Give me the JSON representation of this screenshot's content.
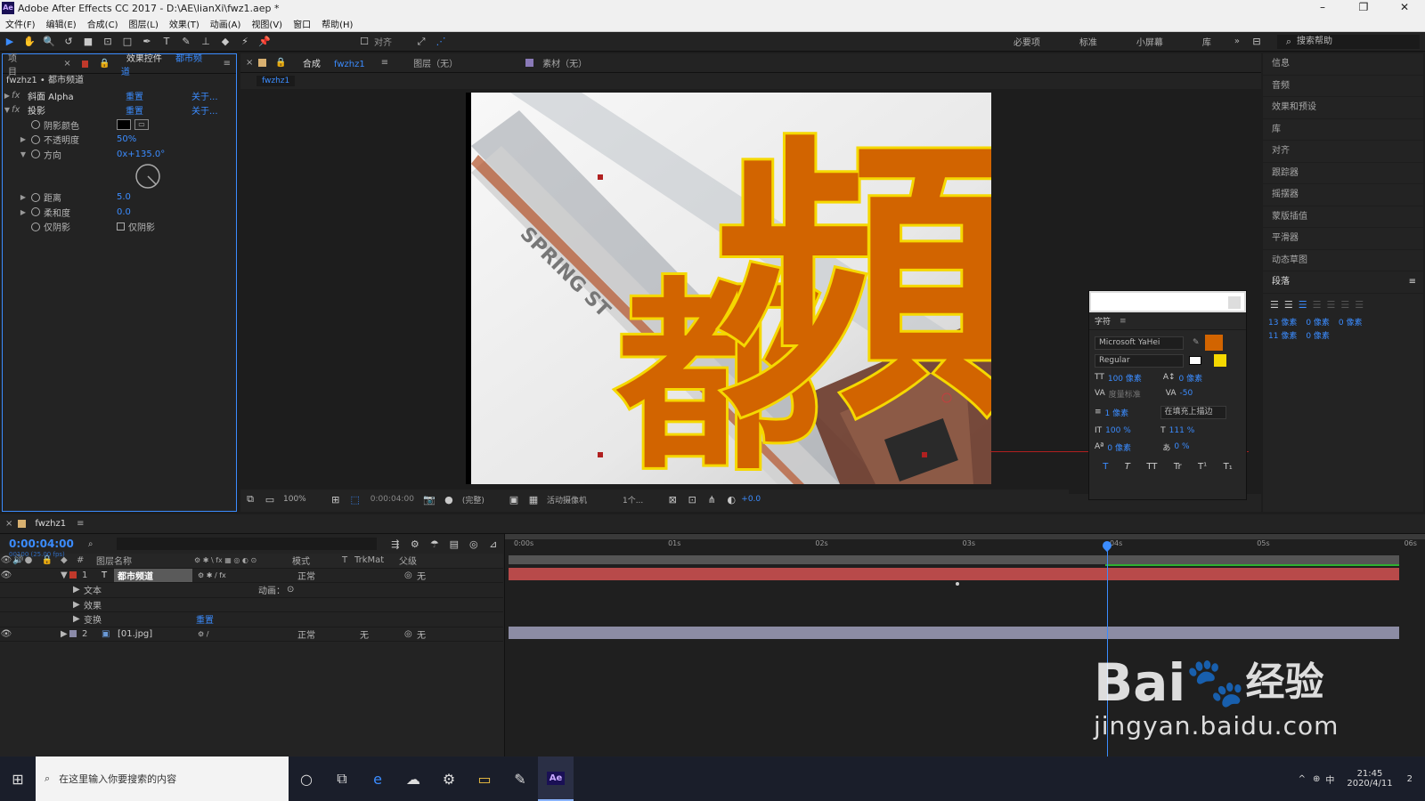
{
  "app": {
    "title": "Adobe After Effects CC 2017 - D:\\AE\\lianXi\\fwz1.aep *",
    "logo": "Ae"
  },
  "window_controls": {
    "minimize": "–",
    "maximize": "❐",
    "close": "✕"
  },
  "menu": [
    "文件(F)",
    "编辑(E)",
    "合成(C)",
    "图层(L)",
    "效果(T)",
    "动画(A)",
    "视图(V)",
    "窗口",
    "帮助(H)"
  ],
  "toolbar": {
    "align_label": "对齐",
    "workspaces": [
      "必要项",
      "标准",
      "小屏幕",
      "库"
    ],
    "more": "»",
    "search_placeholder": "搜索帮助"
  },
  "left_panel": {
    "tab_project": "项目",
    "tab_effects": "效果控件",
    "tab_effects_layer": "都市频道",
    "breadcrumb": "fwzhz1 • 都市频道",
    "effects": [
      {
        "name": "斜面 Alpha",
        "reset": "重置",
        "about": "关于..."
      },
      {
        "name": "投影",
        "reset": "重置",
        "about": "关于..."
      }
    ],
    "props": {
      "shadow_color": "阴影颜色",
      "opacity": "不透明度",
      "opacity_value": "50%",
      "direction": "方向",
      "direction_value": "0x+135.0°",
      "distance": "距离",
      "distance_value": "5.0",
      "softness": "柔和度",
      "softness_value": "0.0",
      "shadow_only": "仅阴影",
      "shadow_only_checkbox": "仅阴影"
    }
  },
  "viewer": {
    "tab_comp_prefix": "合成",
    "tab_comp_name": "fwzhz1",
    "tab_layer": "图层（无）",
    "tab_footage": "素材（无）",
    "sub_tab": "fwzhz1",
    "footer": {
      "zoom": "100%",
      "timecode": "0:00:04:00",
      "quality": "(完整)",
      "camera": "活动摄像机",
      "views": "1个...",
      "exposure": "+0.0"
    },
    "image_text": {
      "hanzi_1": "都",
      "hanzi_2": "頻",
      "street_sign": "SPRING ST"
    }
  },
  "right_panel": {
    "items": [
      "信息",
      "音频",
      "效果和预设",
      "库",
      "对齐",
      "跟踪器",
      "摇摆器",
      "蒙版插值",
      "平滑器",
      "动态草图"
    ],
    "paragraph_title": "段落",
    "para_values": [
      "13 像素",
      "0 像素",
      "0 像素",
      "11 像素",
      "0 像素"
    ]
  },
  "character_panel": {
    "title": "字符",
    "font": "Microsoft YaHei",
    "style": "Regular",
    "size": "100 像素",
    "leading": "0 像素",
    "kerning": "度量标准",
    "tracking": "-50",
    "stroke": "1 像素",
    "stroke_mode": "在填充上描边",
    "vscale": "100 %",
    "hscale": "111 %",
    "baseline": "0 像素",
    "tsume": "0 %",
    "fill_color": "#d26400",
    "stroke_color": "#f5d800",
    "styles": [
      "T",
      "T",
      "TT",
      "Tr",
      "T¹",
      "T₁"
    ]
  },
  "timeline": {
    "tab": "fwzhz1",
    "timecode": "0:00:04:00",
    "fps": "00100 (25.00 fps)",
    "headers": {
      "num": "#",
      "layer_name": "图层名称",
      "mode": "模式",
      "t": "T",
      "trkmat": "TrkMat",
      "parent": "父级"
    },
    "ruler": [
      "0:00s",
      "01s",
      "02s",
      "03s",
      "04s",
      "05s",
      "06s"
    ],
    "layers": [
      {
        "num": "1",
        "type": "T",
        "name": "都市频道",
        "mode": "正常",
        "parent": "无",
        "color": "#c0392b"
      },
      {
        "num": "2",
        "type": "img",
        "name": "[01.jpg]",
        "mode": "正常",
        "trkmat": "无",
        "parent": "无",
        "color": "#8a8aa8"
      }
    ],
    "sub_rows": [
      {
        "label": "文本",
        "extra": "动画："
      },
      {
        "label": "效果",
        "extra": ""
      },
      {
        "label": "变换",
        "extra": "重置"
      }
    ]
  },
  "taskbar": {
    "search_placeholder": "在这里输入你要搜索的内容",
    "time": "21:45",
    "date": "2020/4/11",
    "ime": "中",
    "notif": "2"
  },
  "watermark": {
    "brand": "Bai",
    "brand2": "经验",
    "url": "jingyan.baidu.com"
  }
}
